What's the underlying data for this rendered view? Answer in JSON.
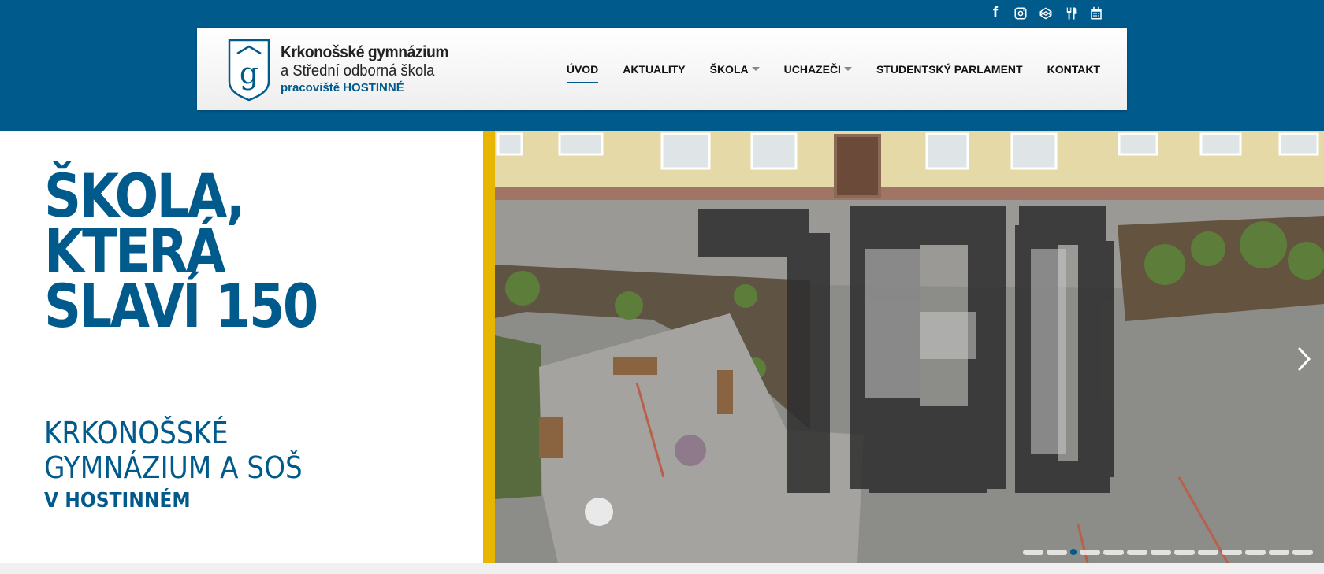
{
  "header": {
    "logo": {
      "mark": "g",
      "line1": "Krkonošské gymnázium",
      "line2": "a Střední odborná škola",
      "line3": "pracoviště HOSTINNÉ"
    },
    "social_icons": [
      "facebook-icon",
      "instagram-icon",
      "codepen-icon",
      "cutlery-icon",
      "calendar-icon"
    ],
    "facebook_glyph": "f",
    "nav": [
      {
        "label": "ÚVOD",
        "active": true,
        "dropdown": false
      },
      {
        "label": "AKTUALITY",
        "active": false,
        "dropdown": false
      },
      {
        "label": "ŠKOLA",
        "active": false,
        "dropdown": true
      },
      {
        "label": "UCHAZEČI",
        "active": false,
        "dropdown": true
      },
      {
        "label": "STUDENTSKÝ PARLAMENT",
        "active": false,
        "dropdown": false
      },
      {
        "label": "KONTAKT",
        "active": false,
        "dropdown": false
      }
    ]
  },
  "hero": {
    "headline": [
      "ŠKOLA,",
      "KTERÁ",
      "SLAVÍ 150"
    ],
    "subtitle_lines": [
      "KRKONOŠSKÉ",
      "GYMNÁZIUM A SOŠ"
    ],
    "subtitle_bold": "V HOSTINNÉM",
    "slider": {
      "dot_count": 13,
      "active_index": 2
    }
  },
  "colors": {
    "brand": "#005a8c",
    "accent": "#e8b600",
    "background": "#f0f0f0"
  }
}
